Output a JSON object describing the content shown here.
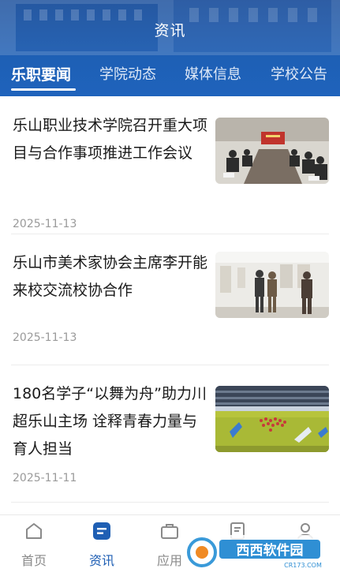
{
  "header": {
    "title": "资讯"
  },
  "tabs": [
    {
      "label": "乐职要闻",
      "active": true
    },
    {
      "label": "学院动态",
      "active": false
    },
    {
      "label": "媒体信息",
      "active": false
    },
    {
      "label": "学校公告",
      "active": false
    }
  ],
  "news": [
    {
      "title": "乐山职业技术学院召开重大项目与合作事项推进工作会议",
      "date": "2025-11-13",
      "thumb": "meeting-photo"
    },
    {
      "title": "乐山市美术家协会主席李开能来校交流校协合作",
      "date": "2025-11-13",
      "thumb": "gallery-photo"
    },
    {
      "title": "180名学子“以舞为舟”助力川超乐山主场  诠释青春力量与育人担当",
      "date": "2025-11-11",
      "thumb": "stadium-photo"
    }
  ],
  "bottom_nav": [
    {
      "label": "首页",
      "icon": "home-icon",
      "active": false
    },
    {
      "label": "资讯",
      "icon": "news-icon",
      "active": true
    },
    {
      "label": "应用",
      "icon": "briefcase-icon",
      "active": false
    },
    {
      "label": "",
      "icon": "document-icon",
      "active": false
    },
    {
      "label": "",
      "icon": "profile-icon",
      "active": false
    }
  ],
  "watermark": {
    "text": "西西软件园",
    "sub": "CR173.COM"
  },
  "colors": {
    "primary": "#1f5fb4",
    "header_dark": "#1c4f9a",
    "text": "#1a1a1a",
    "muted": "#9a9a9a"
  }
}
